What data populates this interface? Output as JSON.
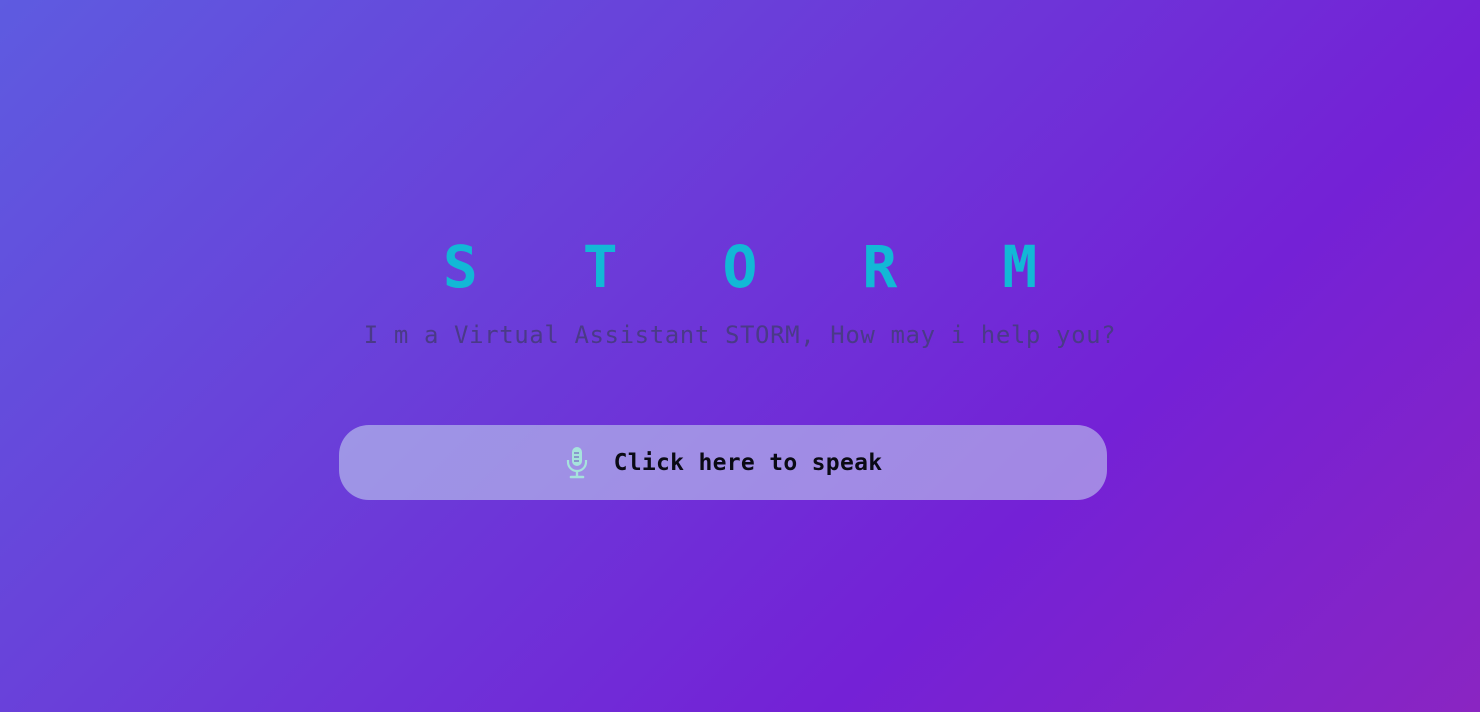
{
  "header": {
    "title": "S T O R M",
    "subtitle": "I m a Virtual Assistant STORM, How may i help you?"
  },
  "speak_button": {
    "label": "Click here to speak",
    "icon": "microphone-icon"
  },
  "colors": {
    "title": "#12b8d6",
    "subtitle": "#4a3a88",
    "mic": "#a6e3dc"
  }
}
